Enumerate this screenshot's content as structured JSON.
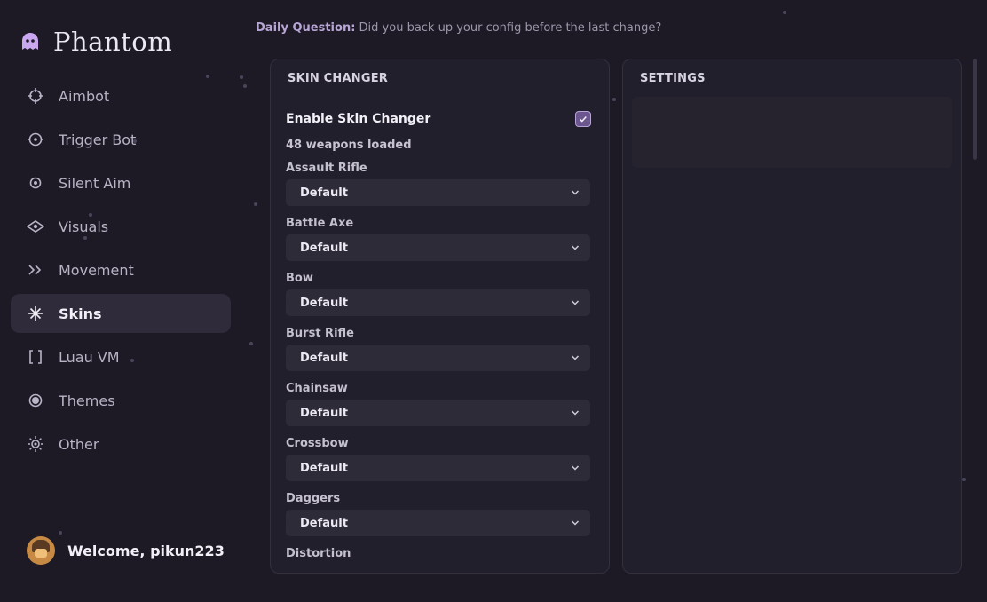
{
  "app": {
    "title": "Phantom"
  },
  "daily": {
    "label": "Daily Question:",
    "question": " Did you back up your config before the last change?"
  },
  "sidebar": {
    "items": [
      {
        "label": "Aimbot",
        "icon": "crosshair-icon",
        "active": false
      },
      {
        "label": "Trigger Bot",
        "icon": "target-icon",
        "active": false
      },
      {
        "label": "Silent Aim",
        "icon": "dot-circle-icon",
        "active": false
      },
      {
        "label": "Visuals",
        "icon": "eye-icon",
        "active": false
      },
      {
        "label": "Movement",
        "icon": "double-chevron-icon",
        "active": false
      },
      {
        "label": "Skins",
        "icon": "sparkle-icon",
        "active": true
      },
      {
        "label": "Luau VM",
        "icon": "brackets-icon",
        "active": false
      },
      {
        "label": "Themes",
        "icon": "filled-circle-icon",
        "active": false
      },
      {
        "label": "Other",
        "icon": "sun-icon",
        "active": false
      }
    ]
  },
  "user": {
    "welcome": "Welcome, pikun223"
  },
  "skin_panel": {
    "title": "SKIN CHANGER",
    "enable_label": "Enable Skin Changer",
    "enable_checked": true,
    "loaded_text": "48 weapons loaded",
    "weapons": [
      {
        "label": "Assault Rifle",
        "value": "Default"
      },
      {
        "label": "Battle Axe",
        "value": "Default"
      },
      {
        "label": "Bow",
        "value": "Default"
      },
      {
        "label": "Burst Rifle",
        "value": "Default"
      },
      {
        "label": "Chainsaw",
        "value": "Default"
      },
      {
        "label": "Crossbow",
        "value": "Default"
      },
      {
        "label": "Daggers",
        "value": "Default"
      },
      {
        "label": "Distortion",
        "value": ""
      }
    ]
  },
  "settings_panel": {
    "title": "SETTINGS"
  },
  "colors": {
    "accent": "#6b5690",
    "background": "#1d1a25",
    "panel": "#221f2c"
  }
}
